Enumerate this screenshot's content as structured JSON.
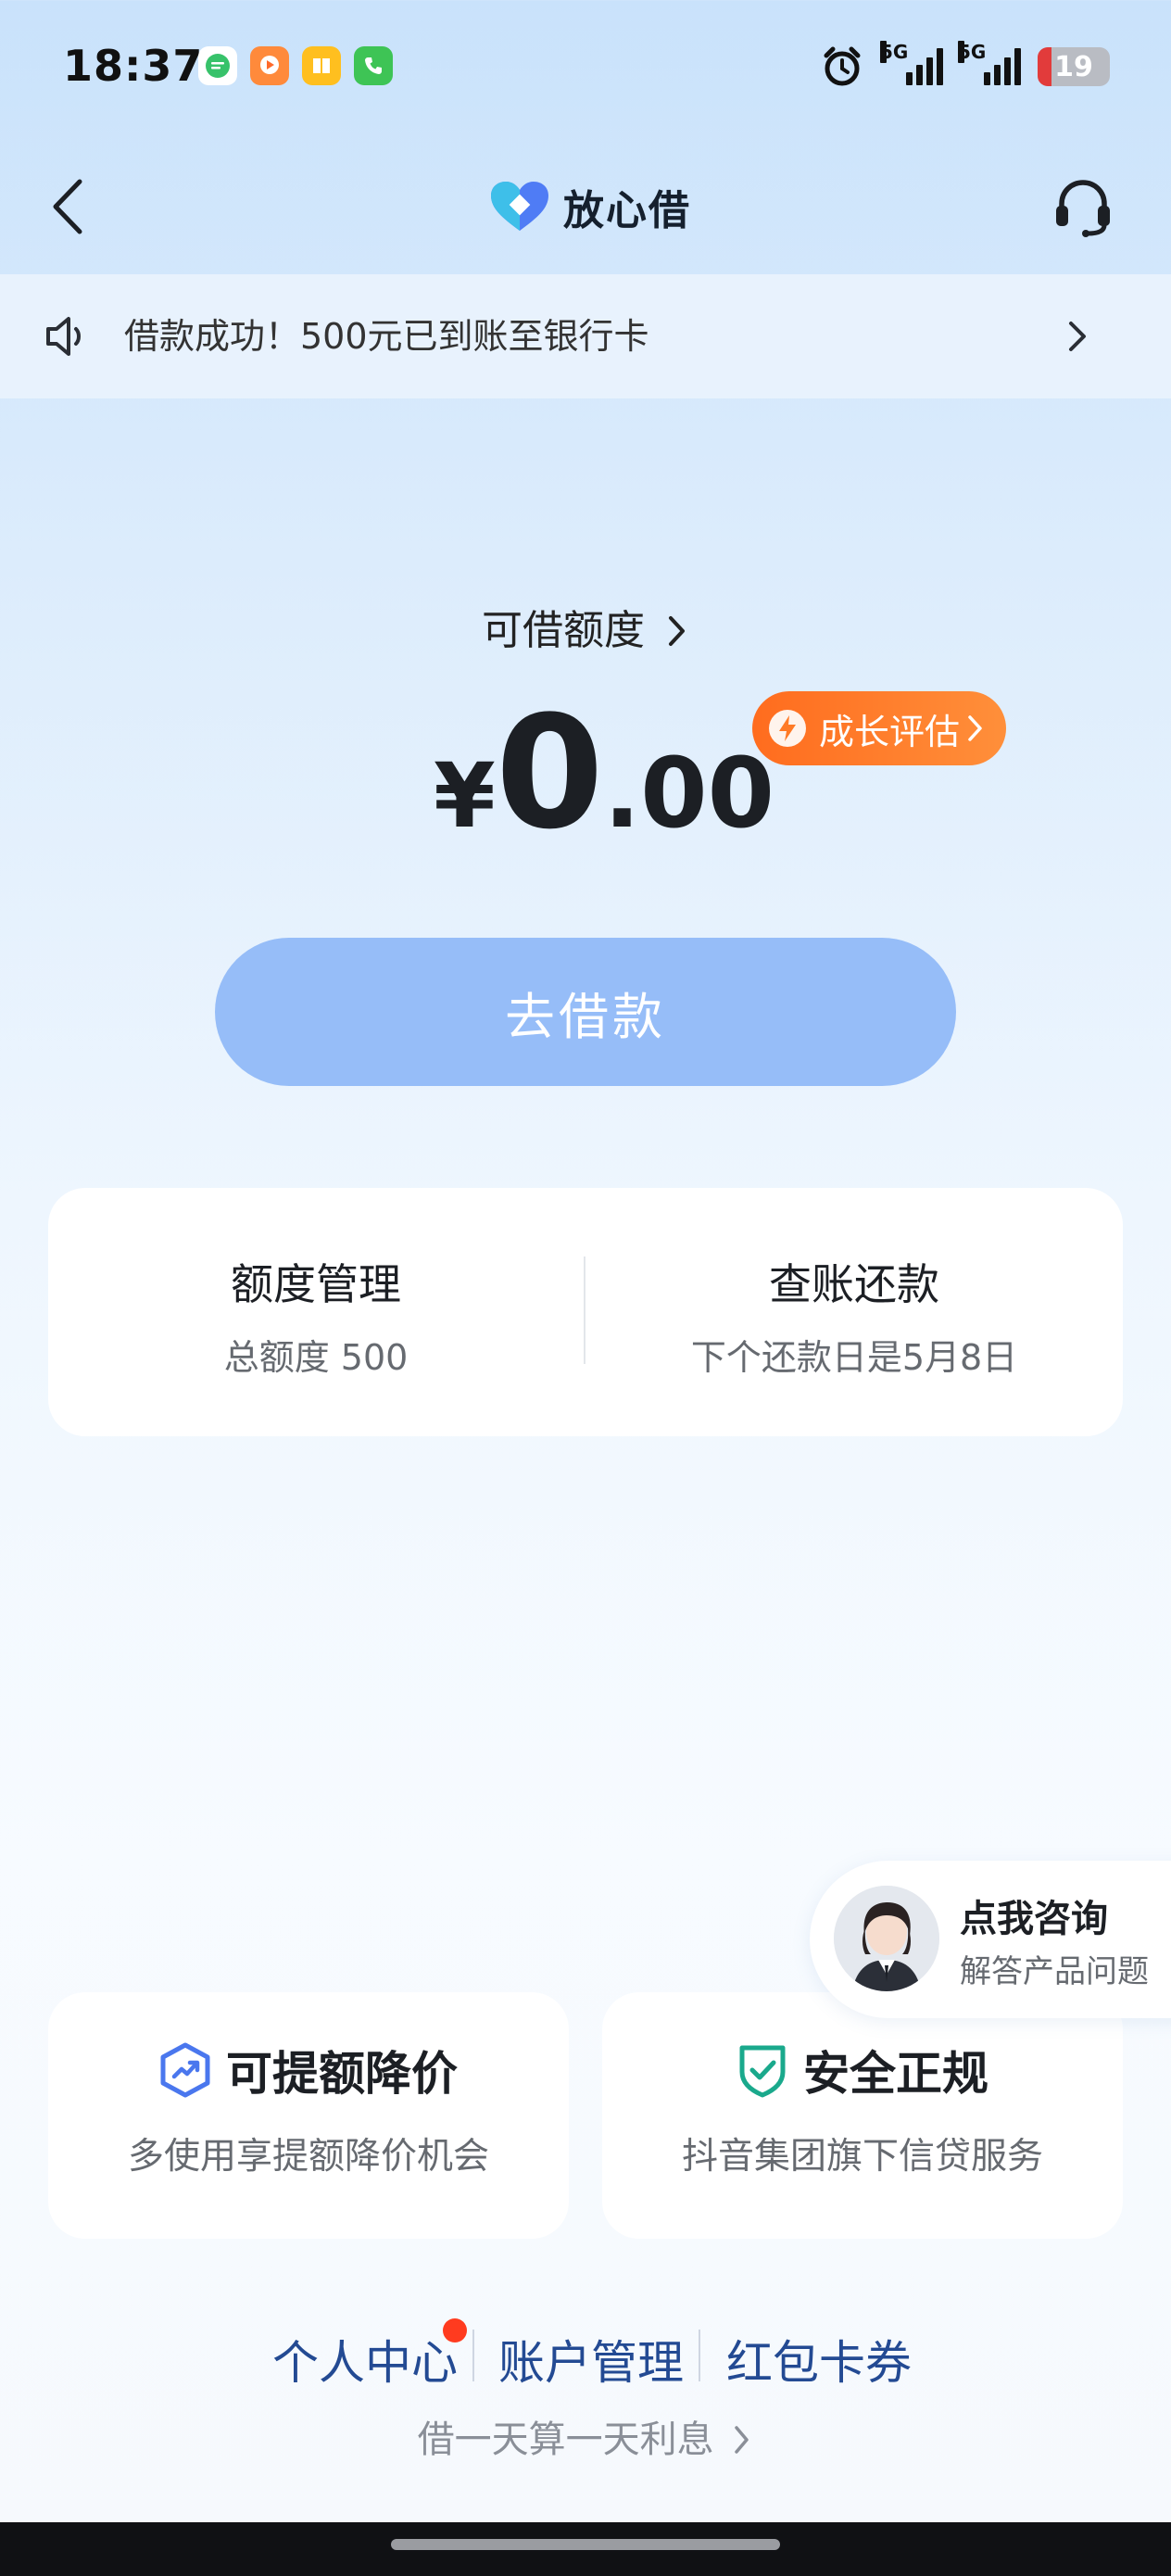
{
  "status_bar": {
    "time": "18:37",
    "network_1": "5G",
    "network_2": "5G",
    "battery": "19",
    "battery_fraction": 0.19,
    "app_icons": [
      "message-icon",
      "video-icon",
      "book-icon",
      "phone-icon"
    ]
  },
  "nav": {
    "title": "放心借"
  },
  "notice": {
    "text": "借款成功！500元已到账至银行卡"
  },
  "credit": {
    "label": "可借额度",
    "currency": "¥",
    "amount_int": "0",
    "amount_dec": ".00",
    "growth_label": "成长评估"
  },
  "borrow_button": {
    "label": "去借款"
  },
  "quota_card": {
    "manage_title": "额度管理",
    "manage_sub": "总额度 500",
    "bill_title": "查账还款",
    "bill_sub": "下个还款日是5月8日"
  },
  "consult": {
    "title": "点我咨询",
    "subtitle": "解答产品问题"
  },
  "features": [
    {
      "title": "可提额降价",
      "subtitle": "多使用享提额降价机会"
    },
    {
      "title": "安全正规",
      "subtitle": "抖音集团旗下信贷服务"
    }
  ],
  "bottom_links": {
    "personal": "个人中心",
    "account": "账户管理",
    "coupons": "红包卡券",
    "slogan": "借一天算一天利息"
  },
  "colors": {
    "accent_blue": "#96bdf8",
    "orange": "#ff6c1e",
    "link_blue": "#234a93",
    "badge_red": "#ff3b1f",
    "shield_green": "#1aa98c"
  }
}
